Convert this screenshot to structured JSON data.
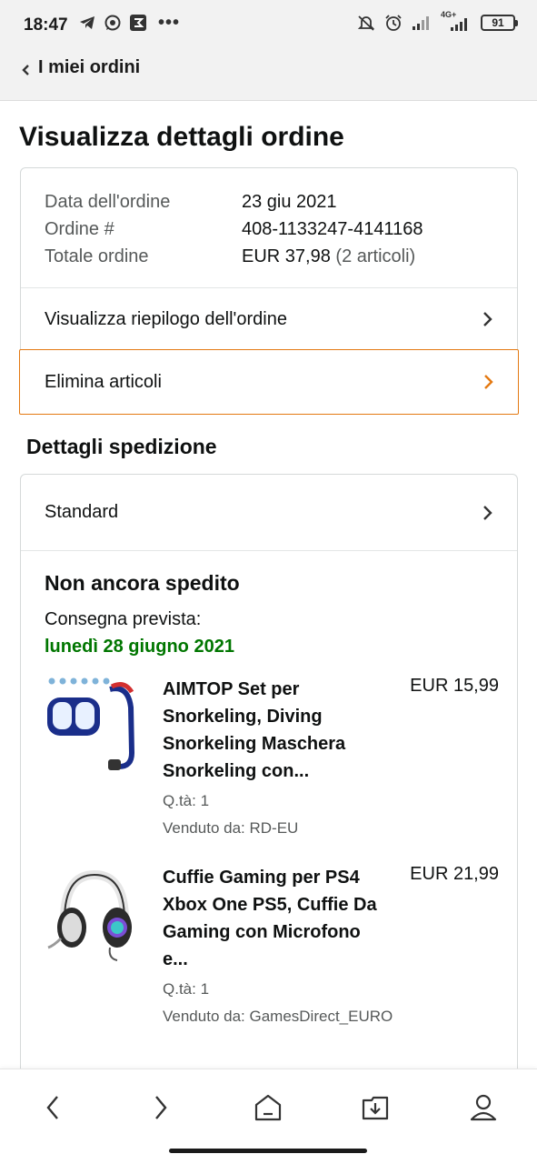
{
  "status_bar": {
    "time": "18:47",
    "network": "4G+",
    "battery": "91",
    "icons": [
      "telegram-icon",
      "whatsapp-icon",
      "app-icon",
      "more-dots",
      "mute-icon",
      "alarm-icon",
      "signal-icon",
      "signal-icon"
    ]
  },
  "header": {
    "back_label": "I miei ordini"
  },
  "page_title": "Visualizza dettagli ordine",
  "order": {
    "date_label": "Data dell'ordine",
    "date_value": "23 giu 2021",
    "number_label": "Ordine #",
    "number_value": "408-1133247-4141168",
    "total_label": "Totale ordine",
    "total_value": "EUR 37,98",
    "total_count": "(2 articoli)",
    "summary_link": "Visualizza riepilogo dell'ordine",
    "delete_link": "Elimina articoli"
  },
  "shipping": {
    "section_title": "Dettagli spedizione",
    "method": "Standard",
    "status": "Non ancora spedito",
    "delivery_label": "Consegna prevista:",
    "delivery_date": "lunedì 28 giugno 2021"
  },
  "items": [
    {
      "title": "AIMTOP Set per Snorkeling, Diving Snorkeling Maschera Snorkeling con...",
      "price": "EUR 15,99",
      "qty": "Q.tà: 1",
      "seller": "Venduto da: RD-EU"
    },
    {
      "title": "Cuffie Gaming per PS4 Xbox One PS5, Cuffie Da Gaming con Microfono e...",
      "price": "EUR 21,99",
      "qty": "Q.tà: 1",
      "seller": "Venduto da: GamesDirect_EURO"
    }
  ],
  "colors": {
    "accent_orange": "#e47911",
    "delivery_green": "#007600",
    "muted_text": "#565959"
  }
}
